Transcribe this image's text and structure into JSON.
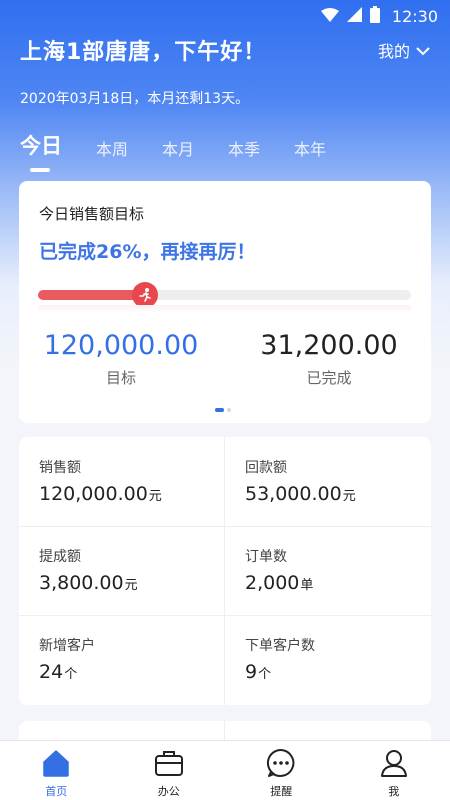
{
  "status_bar": {
    "time": "12:30"
  },
  "header": {
    "greeting": "上海1部唐唐，下午好！",
    "me_menu": "我的",
    "date_line": "2020年03月18日，本月还剩13天。"
  },
  "tabs": [
    {
      "label": "今日",
      "active": true
    },
    {
      "label": "本周",
      "active": false
    },
    {
      "label": "本月",
      "active": false
    },
    {
      "label": "本季",
      "active": false
    },
    {
      "label": "本年",
      "active": false
    }
  ],
  "target_card": {
    "title": "今日销售额目标",
    "progress_text": "已完成26%，再接再厉！",
    "progress_fraction": 0.26,
    "target_value": "120,000.00",
    "target_label": "目标",
    "done_value": "31,200.00",
    "done_label": "已完成",
    "page_dots": 2,
    "active_dot": 0
  },
  "stats_grid": [
    {
      "label": "销售额",
      "value": "120,000.00",
      "unit": "元"
    },
    {
      "label": "回款额",
      "value": "53,000.00",
      "unit": "元"
    },
    {
      "label": "提成额",
      "value": "3,800.00",
      "unit": "元"
    },
    {
      "label": "订单数",
      "value": "2,000",
      "unit": "单"
    },
    {
      "label": "新增客户",
      "value": "24",
      "unit": "个"
    },
    {
      "label": "下单客户数",
      "value": "9",
      "unit": "个"
    }
  ],
  "bottom_nav": [
    {
      "label": "首页",
      "icon": "home-icon",
      "active": true
    },
    {
      "label": "办公",
      "icon": "briefcase-icon",
      "active": false
    },
    {
      "label": "提醒",
      "icon": "chat-bubble-icon",
      "active": false
    },
    {
      "label": "我",
      "icon": "user-icon",
      "active": false
    }
  ],
  "colors": {
    "accent": "#3470e3",
    "progress": "#e85b5e",
    "header_blue": "#2f6ff0"
  }
}
